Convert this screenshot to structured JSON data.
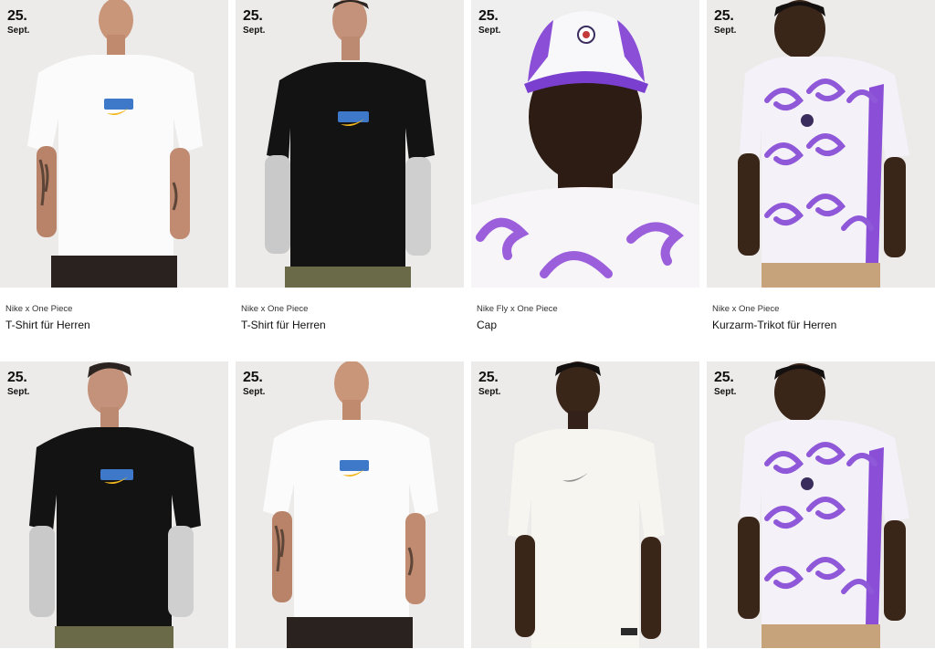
{
  "products": [
    {
      "date_day": "25.",
      "date_month": "Sept.",
      "subtitle": "Nike x One Piece",
      "name": "T-Shirt für Herren",
      "image_kind": "white-tee-tattoo",
      "accent": "#ffffff"
    },
    {
      "date_day": "25.",
      "date_month": "Sept.",
      "subtitle": "Nike x One Piece",
      "name": "T-Shirt für Herren",
      "image_kind": "black-tee-layered",
      "accent": "#121212"
    },
    {
      "date_day": "25.",
      "date_month": "Sept.",
      "subtitle": "Nike Fly x One Piece",
      "name": "Cap",
      "image_kind": "white-purple-cap",
      "accent": "#8a4fd6"
    },
    {
      "date_day": "25.",
      "date_month": "Sept.",
      "subtitle": "Nike x One Piece",
      "name": "Kurzarm-Trikot für Herren",
      "image_kind": "purple-swirl-jersey",
      "accent": "#8a4fd6"
    },
    {
      "date_day": "25.",
      "date_month": "Sept.",
      "image_kind": "black-tee-layered",
      "accent": "#121212"
    },
    {
      "date_day": "25.",
      "date_month": "Sept.",
      "image_kind": "white-tee-tattoo",
      "accent": "#ffffff"
    },
    {
      "date_day": "25.",
      "date_month": "Sept.",
      "image_kind": "offwhite-tee-swoosh",
      "accent": "#f4f3ee"
    },
    {
      "date_day": "25.",
      "date_month": "Sept.",
      "image_kind": "purple-swirl-jersey",
      "accent": "#8a4fd6"
    }
  ]
}
